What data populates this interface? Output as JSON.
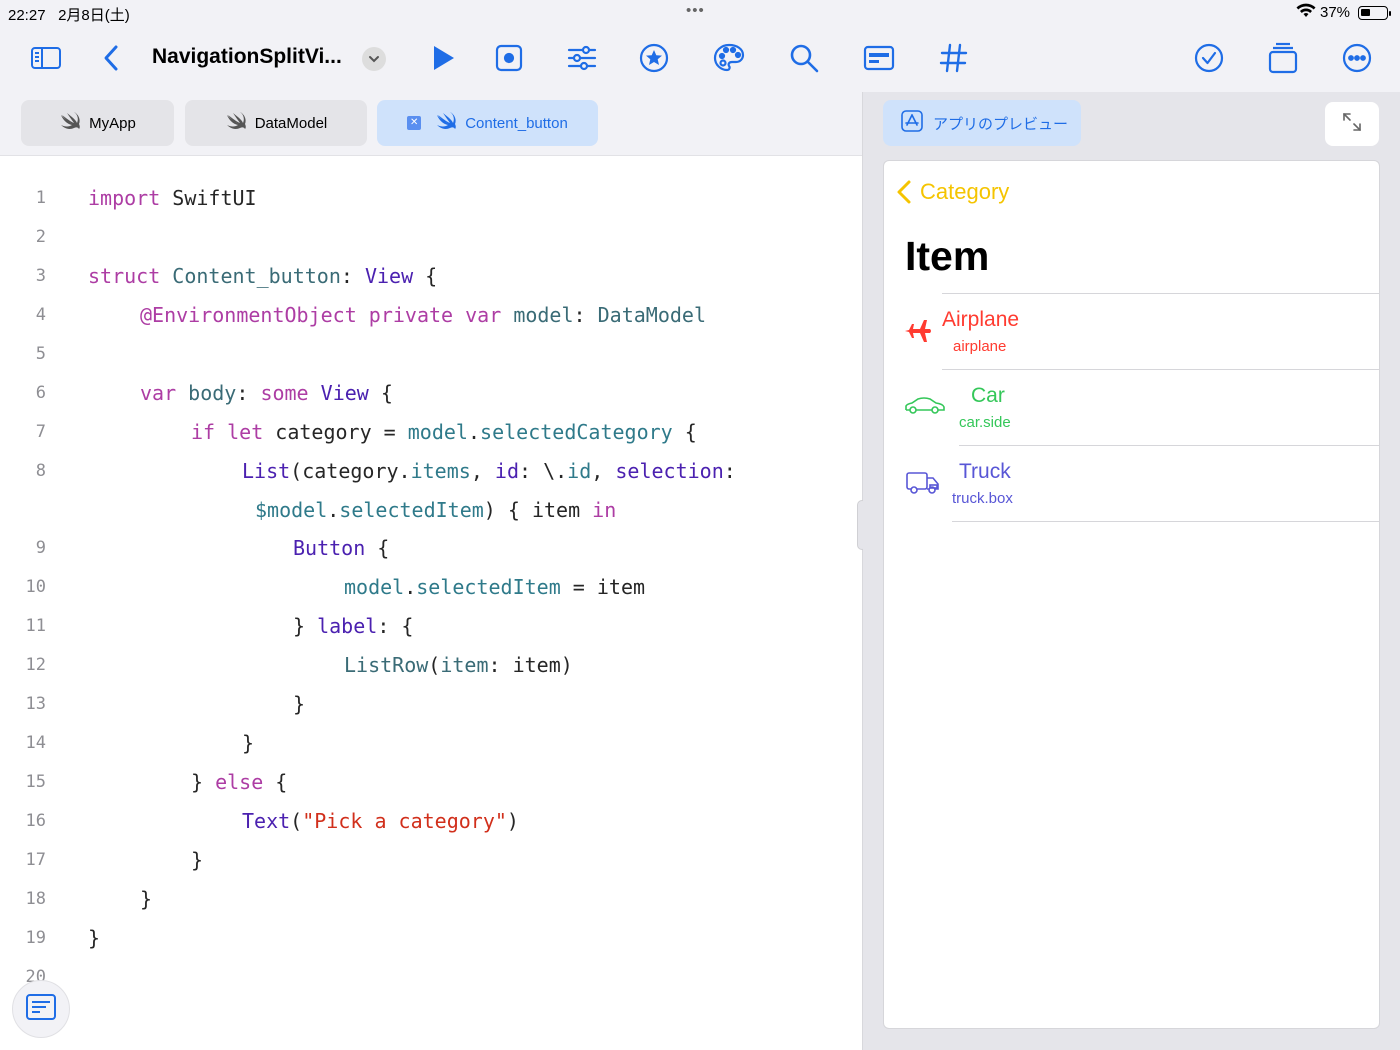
{
  "status": {
    "time": "22:27",
    "date": "2月8日(土)",
    "battery": "37%",
    "center_dots": "•••"
  },
  "toolbar": {
    "title": "NavigationSplitVi..."
  },
  "tabs": [
    {
      "label": "MyApp"
    },
    {
      "label": "DataModel"
    },
    {
      "label": "Content_button"
    }
  ],
  "code_lines": [
    {
      "n": "1"
    },
    {
      "n": "2"
    },
    {
      "n": "3"
    },
    {
      "n": "4"
    },
    {
      "n": "5"
    },
    {
      "n": "6"
    },
    {
      "n": "7"
    },
    {
      "n": "8"
    },
    {
      "n": "9"
    },
    {
      "n": "10"
    },
    {
      "n": "11"
    },
    {
      "n": "12"
    },
    {
      "n": "13"
    },
    {
      "n": "14"
    },
    {
      "n": "15"
    },
    {
      "n": "16"
    },
    {
      "n": "17"
    },
    {
      "n": "18"
    },
    {
      "n": "19"
    },
    {
      "n": "20"
    }
  ],
  "code": {
    "l1": [
      "import",
      " SwiftUI"
    ],
    "l3": [
      "struct",
      " ",
      "Content_button",
      ": ",
      "View",
      " {"
    ],
    "l4": [
      "@EnvironmentObject",
      " ",
      "private",
      " ",
      "var",
      " ",
      "model",
      ": ",
      "DataModel"
    ],
    "l6": [
      "var",
      " ",
      "body",
      ": ",
      "some",
      " ",
      "View",
      " {"
    ],
    "l7": [
      "if",
      " ",
      "let",
      " category = ",
      "model",
      ".",
      "selectedCategory",
      " {"
    ],
    "l8": [
      "List",
      "(category.",
      "items",
      ", ",
      "id",
      ": \\.",
      "id",
      ", ",
      "selection",
      ":"
    ],
    "l8b": [
      "$model",
      ".",
      "selectedItem",
      ") { item ",
      "in"
    ],
    "l9": [
      "Button",
      " {"
    ],
    "l10": [
      "model",
      ".",
      "selectedItem",
      " = item"
    ],
    "l11": [
      "} ",
      "label",
      ": {"
    ],
    "l12": [
      "ListRow",
      "(",
      "item",
      ": item)"
    ],
    "l13": "}",
    "l14": "}",
    "l15": [
      "} ",
      "else",
      " {"
    ],
    "l16": [
      "Text",
      "(",
      "\"Pick a category\"",
      ")"
    ],
    "l17": "}",
    "l18": "}",
    "l19": "}"
  },
  "preview": {
    "button_label": "アプリのプレビュー",
    "back_label": "Category",
    "title": "Item",
    "items": [
      {
        "title": "Airplane",
        "subtitle": "airplane",
        "color": "#ff3b30",
        "icon": "airplane-icon"
      },
      {
        "title": "Car",
        "subtitle": "car.side",
        "color": "#34c759",
        "icon": "car-icon"
      },
      {
        "title": "Truck",
        "subtitle": "truck.box",
        "color": "#5856d6",
        "icon": "truck-icon"
      }
    ]
  },
  "colors": {
    "accent": "#1f6de6",
    "back": "#f5c400"
  }
}
